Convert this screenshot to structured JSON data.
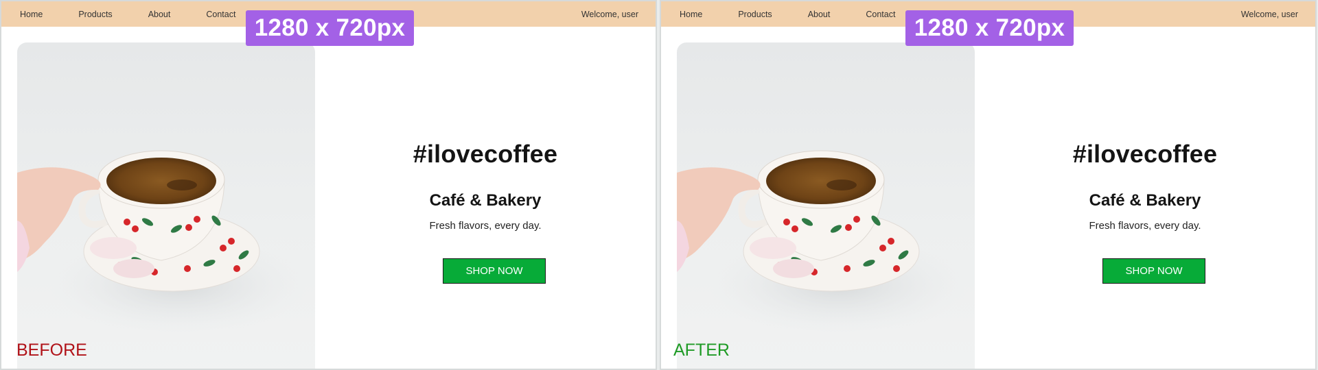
{
  "panels": [
    {
      "state_label": "BEFORE",
      "size_badge": "1280 x 720px",
      "nav": {
        "items": [
          "Home",
          "Products",
          "About",
          "Contact"
        ],
        "welcome": "Welcome, user"
      },
      "hero": {
        "hashtag": "#ilovecoffee",
        "title": "Café & Bakery",
        "tagline": "Fresh flavors, every day.",
        "button": "SHOP NOW"
      }
    },
    {
      "state_label": "AFTER",
      "size_badge": "1280 x 720px",
      "nav": {
        "items": [
          "Home",
          "Products",
          "About",
          "Contact"
        ],
        "welcome": "Welcome, user"
      },
      "hero": {
        "hashtag": "#ilovecoffee",
        "title": "Café & Bakery",
        "tagline": "Fresh flavors, every day.",
        "button": "SHOP NOW"
      }
    }
  ],
  "colors": {
    "navbar_bg": "#f2d1ac",
    "badge_bg": "#a361e6",
    "button_bg": "#07ab38",
    "before_label": "#b01218",
    "after_label": "#1f9b26"
  },
  "icons": {
    "hero_image": "coffee-cup-photo"
  }
}
